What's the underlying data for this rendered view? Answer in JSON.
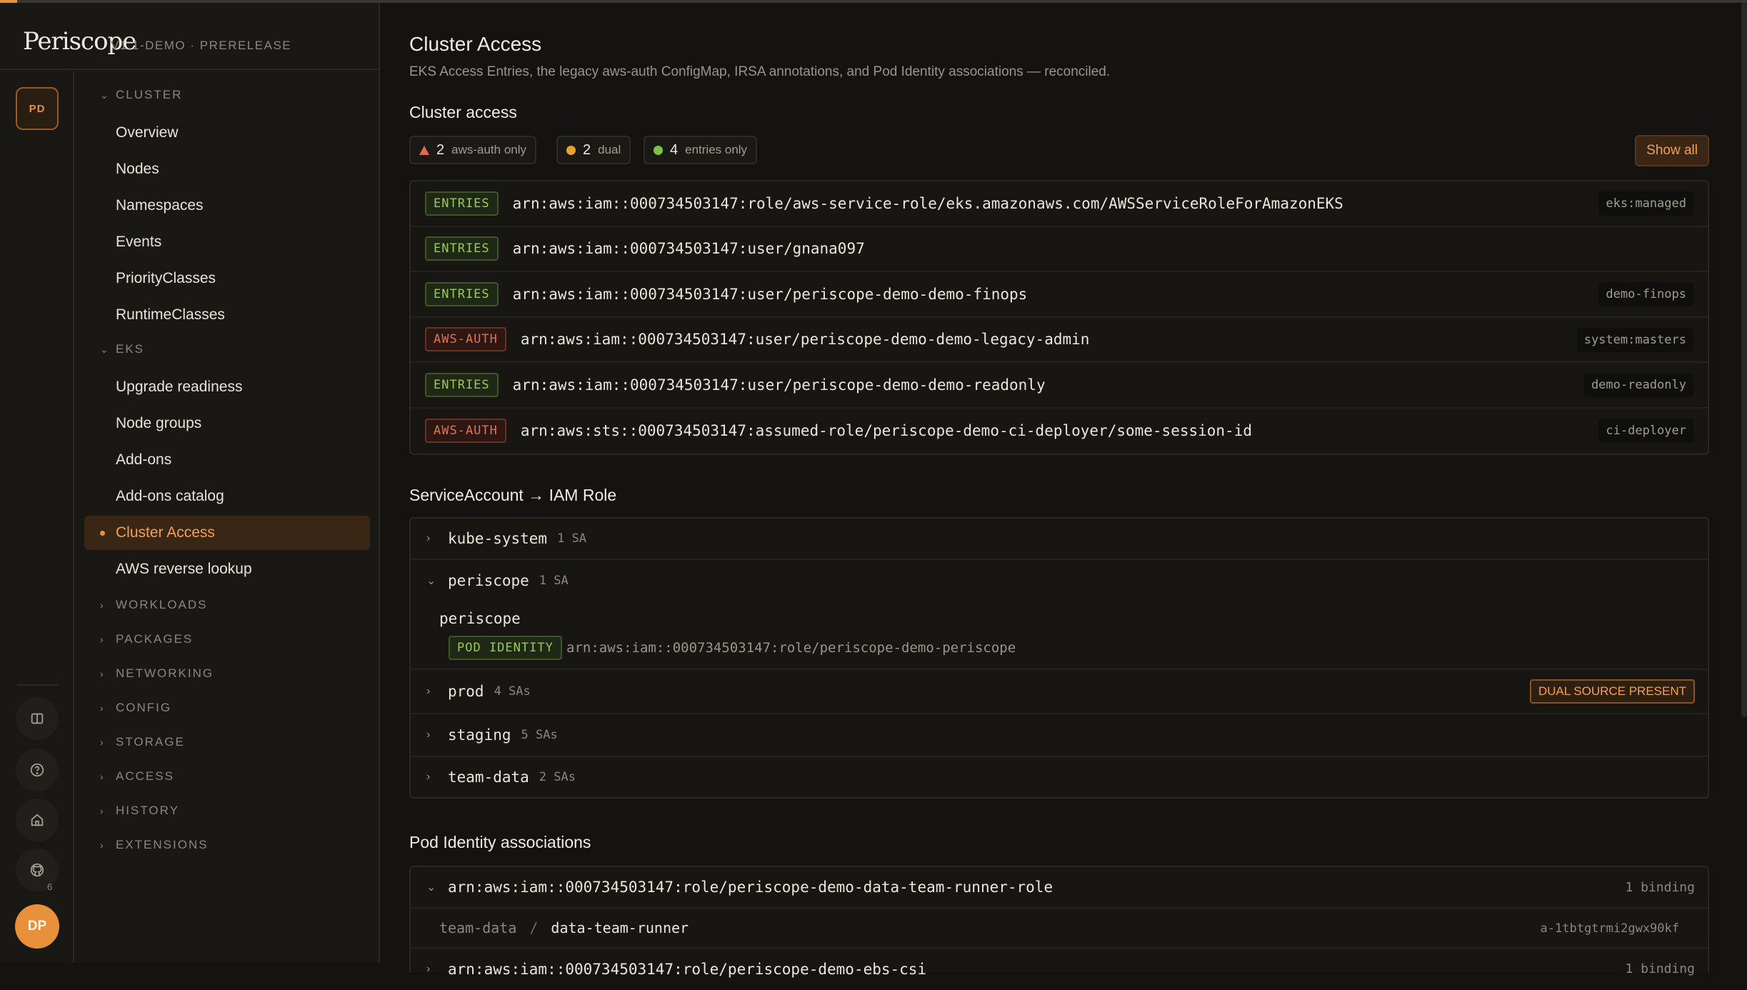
{
  "brand": {
    "logo": "Periscope",
    "version": "V1.1-DEMO · PRERELEASE"
  },
  "rail": {
    "badge": "PD",
    "github_count": "6",
    "avatar": "DP",
    "icons": [
      "book-icon",
      "help-icon",
      "home-icon",
      "github-icon"
    ]
  },
  "nav": {
    "cluster_label": "CLUSTER",
    "cluster_items": [
      "Overview",
      "Nodes",
      "Namespaces",
      "Events",
      "PriorityClasses",
      "RuntimeClasses"
    ],
    "eks_label": "EKS",
    "eks_items": [
      "Upgrade readiness",
      "Node groups",
      "Add-ons",
      "Add-ons catalog",
      "Cluster Access",
      "AWS reverse lookup"
    ],
    "active": "Cluster Access",
    "groups": [
      "WORKLOADS",
      "PACKAGES",
      "NETWORKING",
      "CONFIG",
      "STORAGE",
      "ACCESS",
      "HISTORY",
      "EXTENSIONS"
    ]
  },
  "page": {
    "title": "Cluster Access",
    "subtitle": "EKS Access Entries, the legacy aws-auth ConfigMap, IRSA annotations, and Pod Identity associations — reconciled."
  },
  "cluster_access": {
    "heading": "Cluster access",
    "chips": [
      {
        "count": "2",
        "label": "aws-auth only",
        "color": "#e26a55"
      },
      {
        "count": "2",
        "label": "dual",
        "color": "#e8a12a"
      },
      {
        "count": "4",
        "label": "entries only",
        "color": "#7dc142"
      }
    ],
    "show_all": "Show all",
    "rows": [
      {
        "source": "ENTRIES",
        "arn": "arn:aws:iam::000734503147:role/aws-service-role/eks.amazonaws.com/AWSServiceRoleForAmazonEKS",
        "group": "eks:managed"
      },
      {
        "source": "ENTRIES",
        "arn": "arn:aws:iam::000734503147:user/gnana097",
        "group": ""
      },
      {
        "source": "ENTRIES",
        "arn": "arn:aws:iam::000734503147:user/periscope-demo-demo-finops",
        "group": "demo-finops"
      },
      {
        "source": "AWS-AUTH",
        "arn": "arn:aws:iam::000734503147:user/periscope-demo-demo-legacy-admin",
        "group": "system:masters"
      },
      {
        "source": "ENTRIES",
        "arn": "arn:aws:iam::000734503147:user/periscope-demo-demo-readonly",
        "group": "demo-readonly"
      },
      {
        "source": "AWS-AUTH",
        "arn": "arn:aws:sts::000734503147:assumed-role/periscope-demo-ci-deployer/some-session-id",
        "group": "ci-deployer"
      }
    ]
  },
  "sa_roles": {
    "heading": "ServiceAccount → IAM Role",
    "namespaces": [
      {
        "name": "kube-system",
        "count": "1 SA",
        "expanded": false
      },
      {
        "name": "periscope",
        "count": "1 SA",
        "expanded": true,
        "sa": {
          "name": "periscope",
          "kind": "POD IDENTITY",
          "role": "arn:aws:iam::000734503147:role/periscope-demo-periscope"
        }
      },
      {
        "name": "prod",
        "count": "4 SAs",
        "expanded": false,
        "badge": "DUAL SOURCE PRESENT"
      },
      {
        "name": "staging",
        "count": "5 SAs",
        "expanded": false
      },
      {
        "name": "team-data",
        "count": "2 SAs",
        "expanded": false
      }
    ]
  },
  "pod_identity": {
    "heading": "Pod Identity associations",
    "rows": [
      {
        "role": "arn:aws:iam::000734503147:role/periscope-demo-data-team-runner-role",
        "bindings": "1 binding",
        "sub": {
          "namespace": "team-data",
          "sep": "/",
          "sa": "data-team-runner",
          "id": "a-1tbtgtrmi2gwx90kf"
        }
      },
      {
        "role": "arn:aws:iam::000734503147:role/periscope-demo-ebs-csi",
        "bindings": "1 binding"
      }
    ]
  }
}
